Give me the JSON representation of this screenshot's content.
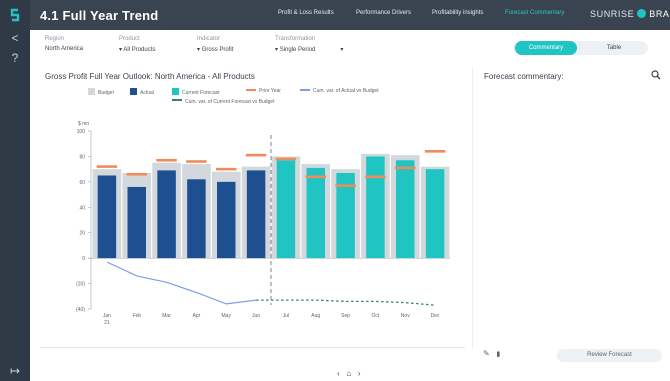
{
  "header": {
    "title": "4.1 Full Year Trend",
    "nav": [
      "Profit & Loss Results",
      "Performance Drivers",
      "Profitability insights",
      "Forecast Commentary"
    ],
    "active_nav": "Forecast Commentary",
    "brand_part1": "SUNRISE",
    "brand_part2": "BRANDS"
  },
  "filters": [
    {
      "label": "Region",
      "value": "North America"
    },
    {
      "label": "Product",
      "value": "All Products"
    },
    {
      "label": "Indicator",
      "value": "Gross Profit"
    },
    {
      "label": "Transformation",
      "value": "Single Period"
    }
  ],
  "view_toggle": {
    "selected": "Commentary",
    "other": "Table"
  },
  "chart_title": "Gross Profit Full Year Outlook: North America - All Products",
  "commentary_title": "Forecast commentary:",
  "legend": [
    {
      "label": "Budget",
      "color": "#d3d8dc",
      "kind": "box"
    },
    {
      "label": "Actual",
      "color": "#1d4f91",
      "kind": "box"
    },
    {
      "label": "Current Forecast",
      "color": "#20c5c3",
      "kind": "box"
    },
    {
      "label": "Prior Year",
      "color": "#f08c5a",
      "kind": "line"
    },
    {
      "label": "Cum. var. of Actual vs Budget",
      "color": "#7f9ee6",
      "kind": "line"
    },
    {
      "label": "Cum. var. of Current Forecast vs Budget",
      "color": "#2e8b57",
      "kind": "dash"
    }
  ],
  "colors": {
    "budget": "#d3d8dc",
    "actual": "#1d4f91",
    "forecast": "#20c5c3",
    "prior_year": "#f08c5a",
    "cum_actual": "#7f9ee6",
    "cum_forecast": "#2e8b57",
    "accent": "#20c5c3",
    "header_bg": "#3a4450"
  },
  "chart_data": {
    "type": "bar",
    "unit_label": "$ mn",
    "categories": [
      "Jan",
      "Feb",
      "Mar",
      "Apr",
      "May",
      "Jun",
      "Jul",
      "Aug",
      "Sep",
      "Oct",
      "Nov",
      "Dec"
    ],
    "year_label": "21",
    "ylim": [
      -40,
      100
    ],
    "yticks": [
      -40,
      -20,
      0,
      20,
      40,
      60,
      80,
      100
    ],
    "ytick_labels": [
      "(40)",
      "(20)",
      "0",
      "20",
      "40",
      "60",
      "80",
      "100"
    ],
    "series": [
      {
        "name": "Budget",
        "values": [
          70,
          67,
          75,
          74,
          68,
          72,
          80,
          74,
          70,
          82,
          81,
          72
        ]
      },
      {
        "name": "Actual",
        "values": [
          65,
          56,
          69,
          62,
          60,
          69,
          null,
          null,
          null,
          null,
          null,
          null
        ]
      },
      {
        "name": "Current Forecast",
        "values": [
          null,
          null,
          null,
          null,
          null,
          null,
          77,
          71,
          67,
          80,
          77,
          70
        ]
      },
      {
        "name": "Prior Year",
        "values": [
          72,
          66,
          77,
          76,
          70,
          81,
          78,
          64,
          57,
          64,
          71,
          84
        ]
      },
      {
        "name": "Cum. var. of Actual vs Budget",
        "values": [
          -3,
          -14,
          -19,
          -27,
          -36,
          -33,
          null,
          null,
          null,
          null,
          null,
          null
        ]
      },
      {
        "name": "Cum. var. of Current Forecast vs Budget",
        "values": [
          null,
          null,
          null,
          null,
          null,
          -33,
          -33,
          -33,
          -34,
          -34,
          -35,
          -37
        ]
      }
    ],
    "divider_after": "Jun"
  },
  "footer": {
    "prev": "‹",
    "home": "⌂",
    "next": "›",
    "edit_icon": "✎",
    "delete_icon": "🗑",
    "review_button": "Review Forecast"
  }
}
